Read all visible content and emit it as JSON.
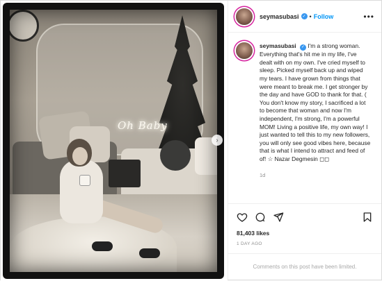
{
  "post": {
    "photo": {
      "neon_sign": "Oh Baby"
    },
    "header": {
      "username": "seymasubasi",
      "separator": "•",
      "follow_label": "Follow",
      "more_label": "•••"
    },
    "caption": {
      "username": "seymasubasi",
      "text": "I'm a strong woman. Everything that's hit me in my life, I've dealt with on my own. I've cried myself to sleep. Picked myself back up and wiped my tears. I have grown from things that were meant to break me. I get stronger by the day and have GOD to thank for that. ( You don't know my story, I sacrificed a lot to become that woman and now I'm independent, I'm strong, I'm a powerful MOM! Living a positive life, my own way! I just wanted to tell this to my new followers, you will only see good vibes here, because that is what I intend to attract and feed of of! ☆ Nazar Degmesin ◻◻",
      "time_ago": "1d"
    },
    "actions": {
      "icons": [
        "heart-icon",
        "comment-icon",
        "share-icon",
        "bookmark-icon"
      ]
    },
    "likes": "81,403 likes",
    "date": "1 DAY AGO",
    "comments_notice": "Comments on this post have been limited.",
    "colors": {
      "accent": "#0095f6",
      "verified": "#3897f0",
      "muted": "#8e8e8e"
    }
  }
}
